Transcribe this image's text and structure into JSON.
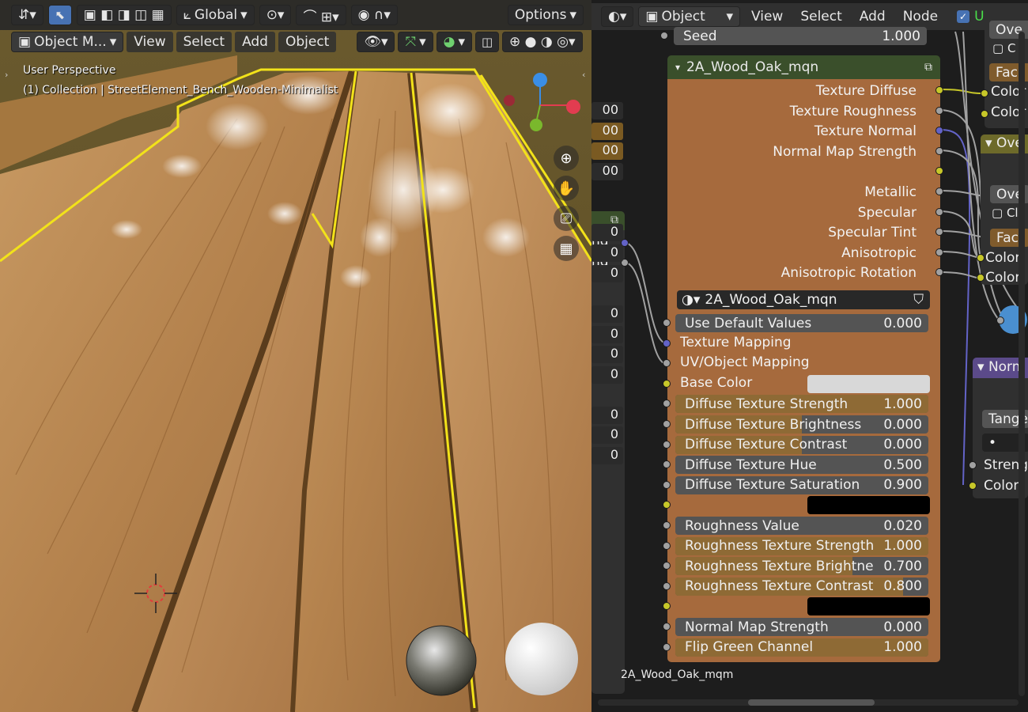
{
  "viewport": {
    "toolbar": {
      "transform_orientation": "Global",
      "options_label": "Options"
    },
    "header": {
      "mode": "Object M...",
      "menus": [
        "View",
        "Select",
        "Add",
        "Object"
      ]
    },
    "overlay": {
      "perspective": "User Perspective",
      "collection": "(1) Collection | StreetElement_Bench_Wooden-Minimalist"
    }
  },
  "node_editor": {
    "header": {
      "object_label": "Object",
      "menus": [
        "View",
        "Select",
        "Add",
        "Node"
      ],
      "use_nodes_label": "Use Node"
    },
    "seed": {
      "label": "Seed",
      "value": "1.000"
    },
    "main_node": {
      "title": "2A_Wood_Oak_mqn",
      "outputs": [
        "Texture Diffuse",
        "Texture Roughness",
        "Texture Normal",
        "Normal Map Strength",
        "",
        "Metallic",
        "Specular",
        "Specular Tint",
        "Anisotropic",
        "Anisotropic Rotation"
      ],
      "group_name": "2A_Wood_Oak_mqn",
      "inputs": [
        {
          "label": "Use Default Values",
          "value": "0.000",
          "kind": "field",
          "fill": 0
        },
        {
          "label": "Texture Mapping",
          "kind": "label"
        },
        {
          "label": "UV/Object Mapping",
          "kind": "label"
        },
        {
          "label": "Base Color",
          "kind": "color"
        },
        {
          "label": "Diffuse Texture Strength",
          "value": "1.000",
          "kind": "field",
          "fill": 1.0
        },
        {
          "label": "Diffuse Texture Brightness",
          "value": "0.000",
          "kind": "field",
          "fill": 0.5
        },
        {
          "label": "Diffuse Texture Contrast",
          "value": "0.000",
          "kind": "field",
          "fill": 0.5
        },
        {
          "label": "Diffuse Texture Hue",
          "value": "0.500",
          "kind": "field",
          "fill": 0
        },
        {
          "label": "Diffuse Texture Saturation",
          "value": "0.900",
          "kind": "field",
          "fill": 0
        },
        {
          "label": "",
          "kind": "black"
        },
        {
          "label": "Roughness Value",
          "value": "0.020",
          "kind": "field",
          "fill": 0
        },
        {
          "label": "Roughness Texture Strength",
          "value": "1.000",
          "kind": "field",
          "fill": 1.0
        },
        {
          "label": "Roughness Texture Brightne",
          "value": "0.700",
          "kind": "field",
          "fill": 0.7
        },
        {
          "label": "Roughness Texture Contrast",
          "value": "0.800",
          "kind": "field",
          "fill": 0.9
        },
        {
          "label": "",
          "kind": "black"
        },
        {
          "label": "Normal Map Strength",
          "value": "0.000",
          "kind": "field",
          "fill": 0
        },
        {
          "label": "Flip Green Channel",
          "value": "1.000",
          "kind": "field",
          "fill": 1.0
        }
      ]
    },
    "left_node": {
      "outputs": [
        "ng",
        "ng"
      ],
      "values": [
        "00",
        "00",
        "00",
        "00",
        "0",
        "0",
        "0",
        "0",
        "0",
        "0",
        "0",
        "0",
        "0",
        "0"
      ]
    },
    "right_nodes": {
      "labels": [
        "Ove",
        "C",
        "Fac",
        "Color",
        "Color",
        "Ove",
        "Ove",
        "Cl",
        "Fac",
        "Color",
        "Color",
        "Norm",
        "Tange",
        "•",
        "Streng",
        "Color"
      ]
    },
    "frame_label": "2A_Wood_Oak_mqm"
  }
}
